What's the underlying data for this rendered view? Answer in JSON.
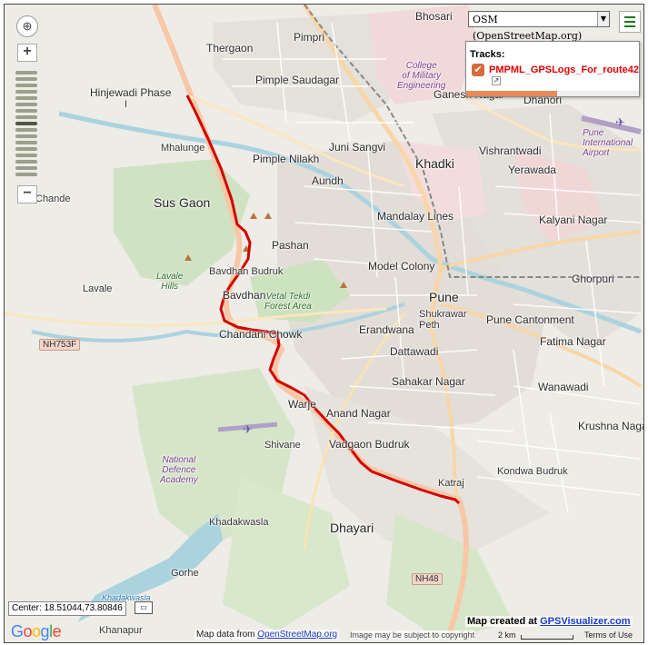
{
  "map": {
    "layer_selected": "OSM (OpenStreetMap.org)",
    "track_color": "#d40000",
    "places": {
      "bhosari": "Bhosari",
      "pimpri": "Pimpri",
      "thergaon": "Thergaon",
      "pimple_saudagar": "Pimple Saudagar",
      "hinjewadi": "Hinjewadi Phase",
      "hinjewadi_suffix": "I",
      "college": "College\nof Military\nEngineering",
      "ganesh_nagar": "Ganesh Nagar",
      "dhanori": "Dhanori",
      "airport": "Pune International\nAirport",
      "mhalunge": "Mhalunge",
      "juni_sangvi": "Juni Sangvi",
      "vishrantwadi": "Vishrantwadi",
      "pimple_nilakh": "Pimple Nilakh",
      "khadki": "Khadki",
      "yerawada": "Yerawada",
      "aundh": "Aundh",
      "chande": "Chande",
      "sus_gaon": "Sus Gaon",
      "mandalay_lines": "Mandalay Lines",
      "kalyani_nagar": "Kalyani Nagar",
      "pashan": "Pashan",
      "lavale_hills": "Lavale\nHills",
      "bavdhan_budruk": "Bavdhan Budruk",
      "model_colony": "Model Colony",
      "ghorpuri": "Ghorpuri",
      "lavale": "Lavale",
      "vetal_tekdi": "Vetal Tekdi\nForest Area",
      "pune": "Pune",
      "bavdhan": "Bavdhan",
      "shukrawar_peth": "Shukrawar\nPeth",
      "pune_cantonment": "Pune Cantonment",
      "erandwana": "Erandwana",
      "chandani_chowk": "Chandani Chowk",
      "fatima_nagar": "Fatima Nagar",
      "dattawadi": "Dattawadi",
      "sahakar_nagar": "Sahakar Nagar",
      "wanawadi": "Wanawadi",
      "warje": "Warje",
      "anand_nagar": "Anand Nagar",
      "krushna_nagar": "Krushna Nagar",
      "shivane": "Shivane",
      "vadgaon_budruk": "Vadgaon Budruk",
      "nda": "National\nDefence\nAcademy",
      "kondwa_budruk": "Kondwa Budruk",
      "katraj": "Katraj",
      "khadakwasla": "Khadakwasla",
      "dhayari": "Dhayari",
      "gorhe": "Gorhe",
      "khadakwasla_lake": "Khadakwasla\nLake",
      "khanapur": "Khanapur"
    },
    "shields": {
      "nh753f": "NH753F",
      "nh48": "NH48"
    }
  },
  "controls": {
    "compass_symbol": "⊕",
    "zoom_in": "+",
    "zoom_out": "−",
    "menu_icon": "hamburger-menu"
  },
  "tracks_panel": {
    "title": "Tracks:",
    "track_name": "PMPML_GPSLogs_For_route42",
    "checkbox_mark": "✔",
    "link_mark": "↗"
  },
  "footer": {
    "center_text": "Center: 18.51044,73.80846",
    "google_letters": [
      "G",
      "o",
      "o",
      "g",
      "l",
      "e"
    ],
    "google_colors": [
      "#4285f4",
      "#ea4335",
      "#fbbc05",
      "#4285f4",
      "#34a853",
      "#ea4335"
    ],
    "map_data_prefix": "Map data from ",
    "map_data_link": "OpenStreetMap.org",
    "disclaimer": "Image may be subject to copyright",
    "scale_label": "2 km",
    "terms": "Terms of Use",
    "credit_prefix": "Map created at ",
    "credit_link": "GPSVisualizer.com"
  }
}
